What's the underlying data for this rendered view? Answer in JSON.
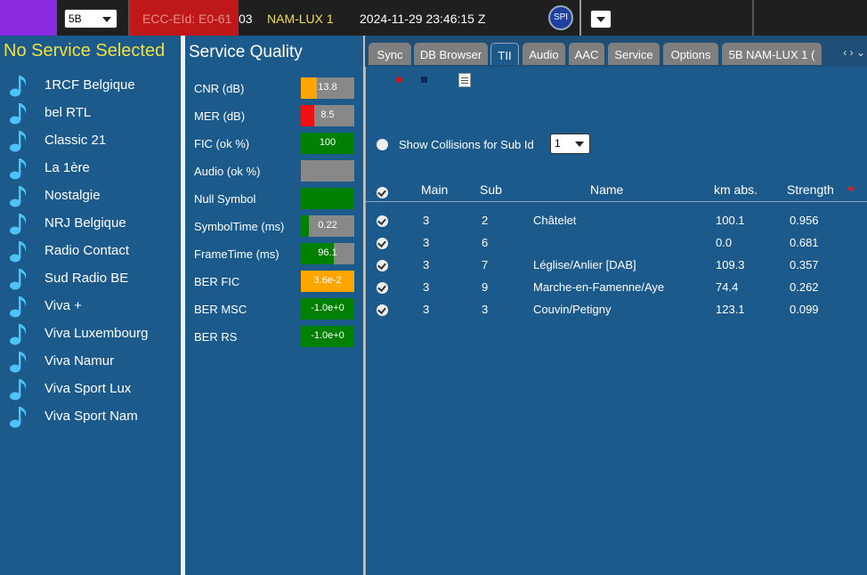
{
  "topbar": {
    "channel": "5B",
    "ecc_eid_head": "ECC-EId: E0-61",
    "ecc_eid_tail": "03",
    "ensemble": "NAM-LUX 1",
    "datetime": "2024-11-29  23:46:15 Z",
    "spi_label": "SPI"
  },
  "left": {
    "title": "No Service Selected",
    "services": [
      "1RCF Belgique",
      "bel RTL",
      "Classic 21",
      "La 1ère",
      "Nostalgie",
      "NRJ Belgique",
      "Radio Contact",
      "Sud Radio BE",
      "Viva +",
      "Viva Luxembourg",
      "Viva Namur",
      "Viva Sport Lux",
      "Viva Sport Nam"
    ]
  },
  "quality": {
    "title": "Service Quality",
    "rows": [
      {
        "label": "CNR (dB)",
        "value": "13.8",
        "level": 0.3,
        "color": "#ffa500"
      },
      {
        "label": "MER (dB)",
        "value": "8.5",
        "level": 0.25,
        "color": "#ee1111"
      },
      {
        "label": "FIC (ok %)",
        "value": "100",
        "level": 1.0,
        "color": "#008000"
      },
      {
        "label": "Audio (ok %)",
        "value": "",
        "level": 0.0,
        "color": "#008000"
      },
      {
        "label": "Null Symbol",
        "value": "",
        "level": 1.0,
        "color": "#008000"
      },
      {
        "label": "SymbolTime (ms)",
        "value": "0.22",
        "level": 0.15,
        "color": "#008000"
      },
      {
        "label": "FrameTime (ms)",
        "value": "96.1",
        "level": 0.62,
        "color": "#008000"
      },
      {
        "label": "BER FIC",
        "value": "3.6e-2",
        "level": 1.0,
        "color": "#ffa500"
      },
      {
        "label": "BER MSC",
        "value": "-1.0e+0",
        "level": 1.0,
        "color": "#008000"
      },
      {
        "label": "BER RS",
        "value": "-1.0e+0",
        "level": 1.0,
        "color": "#008000"
      }
    ]
  },
  "tabs": [
    "Sync",
    "DB Browser",
    "TII",
    "Audio",
    "AAC",
    "Service",
    "Options",
    "5B NAM-LUX 1 ("
  ],
  "tab_nav": "‹ › ⌄",
  "tii": {
    "show_collisions_label": "Show Collisions for Sub Id",
    "sub_id": "1",
    "columns": [
      "Main",
      "Sub",
      "Name",
      "km abs.",
      "Strength"
    ],
    "rows": [
      {
        "main": "3",
        "sub": "2",
        "name": "Châtelet",
        "km": "100.1",
        "strength": "0.956"
      },
      {
        "main": "3",
        "sub": "6",
        "name": "",
        "km": "0.0",
        "strength": "0.681"
      },
      {
        "main": "3",
        "sub": "7",
        "name": "Léglise/Anlier [DAB]",
        "km": "109.3",
        "strength": "0.357"
      },
      {
        "main": "3",
        "sub": "9",
        "name": "Marche-en-Famenne/Aye",
        "km": "74.4",
        "strength": "0.262"
      },
      {
        "main": "3",
        "sub": "3",
        "name": "Couvin/Petigny",
        "km": "123.1",
        "strength": "0.099"
      }
    ]
  }
}
